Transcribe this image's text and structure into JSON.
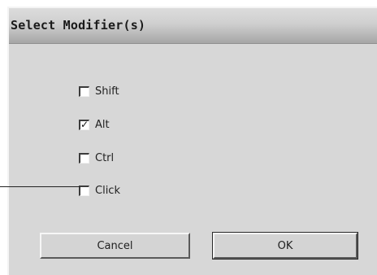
{
  "dialog": {
    "title": "Select Modifier(s)"
  },
  "options": [
    {
      "label": "Shift",
      "checked": false
    },
    {
      "label": "Alt",
      "checked": true
    },
    {
      "label": "Ctrl",
      "checked": false
    },
    {
      "label": "Click",
      "checked": false
    }
  ],
  "buttons": {
    "cancel_label": "Cancel",
    "ok_label": "OK"
  },
  "checkmark_glyph": "✓"
}
